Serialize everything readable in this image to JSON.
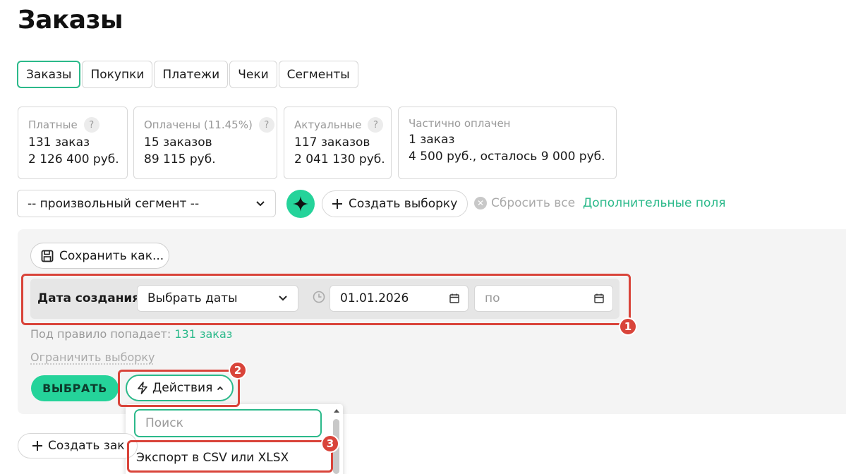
{
  "page": {
    "title": "Заказы"
  },
  "tabs": [
    {
      "label": "Заказы",
      "active": true
    },
    {
      "label": "Покупки"
    },
    {
      "label": "Платежи"
    },
    {
      "label": "Чеки"
    },
    {
      "label": "Сегменты"
    }
  ],
  "cards": [
    {
      "title": "Платные",
      "help": "?",
      "line1": "131 заказ",
      "line2": "2 126 400 руб."
    },
    {
      "title": "Оплачены (11.45%)",
      "help": "?",
      "line1": "15 заказов",
      "line2": "89 115 руб."
    },
    {
      "title": "Актуальные",
      "help": "?",
      "line1": "117 заказов",
      "line2": "2 041 130 руб."
    },
    {
      "title": "Частично оплачен",
      "line1": "1 заказ",
      "line2": "4 500 руб., осталось 9 000 руб."
    }
  ],
  "toolbar": {
    "segment": "-- произвольный сегмент --",
    "create_selection": "Создать выборку",
    "reset_all": "Сбросить все",
    "extra_fields": "Дополнительные поля"
  },
  "filter": {
    "save_as": "Сохранить как...",
    "label": "Дата создания",
    "mode": "Выбрать даты",
    "from": "01.01.2026",
    "to_placeholder": "по",
    "rule_prefix": "Под правило попадает:",
    "rule_count": "131 заказ",
    "limit": "Ограничить выборку",
    "select_button": "ВЫБРАТЬ",
    "actions_button": "Действия"
  },
  "dropdown": {
    "search_placeholder": "Поиск",
    "items": [
      "Экспорт в CSV или XLSX"
    ]
  },
  "create_order": "Создать зак",
  "badges": [
    "1",
    "2",
    "3"
  ],
  "colors": {
    "accent": "#2bb98a",
    "accent_fill": "#25d39a",
    "highlight": "#d9443a"
  }
}
